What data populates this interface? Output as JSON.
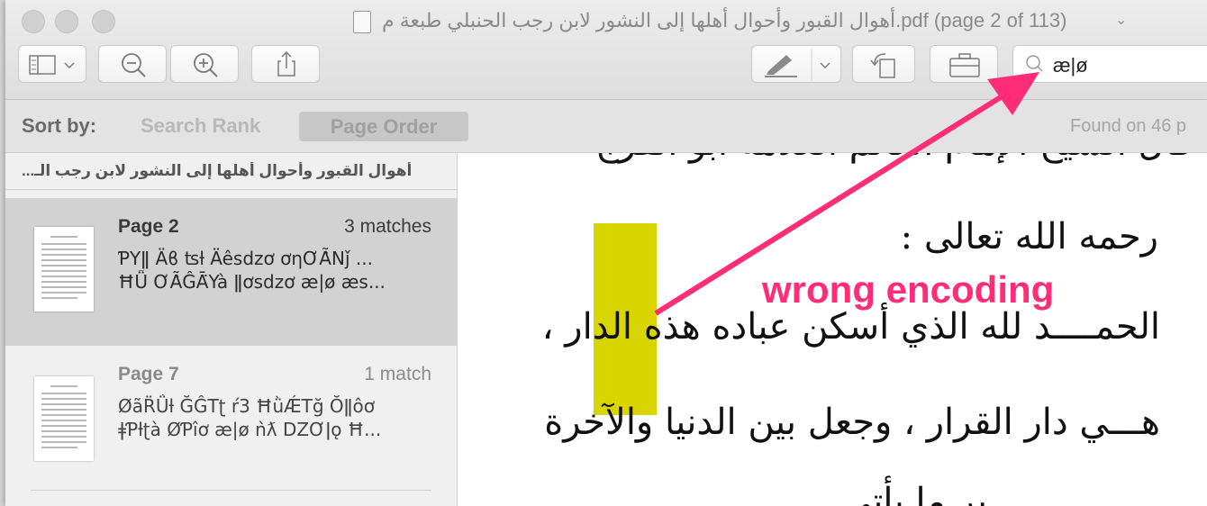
{
  "window": {
    "title": "أهوال القبور وأحوال أهلها إلى النشور لابن رجب الحنبلي طبعة م.pdf (page 2 of 113)"
  },
  "toolbar": {
    "buttons": [
      "sidebar-toggle",
      "zoom-out",
      "zoom-in",
      "share",
      "markup",
      "rotate",
      "toolbox"
    ],
    "search_value": "æ|ø"
  },
  "sortbar": {
    "label": "Sort by:",
    "options": [
      "Search Rank",
      "Page Order"
    ],
    "selected": "Page Order",
    "found": "Found on 46 p"
  },
  "sidebar": {
    "document_title": "أهوال القبور وأحوال أهلها إلى النشور لابن رجب الـ...",
    "results": [
      {
        "page": "Page 2",
        "matches": "3 matches",
        "snippet_line1": "ƤYǁ Äϐ ʦƚ Äêsdzơ ơƞƠÃ̀Nǰ ...",
        "snippet_line2": "ĦǕ ƠÃ̀ĜĀ̈Yà ǁơsdzơ æ|ø æs...",
        "selected": true
      },
      {
        "page": "Page 7",
        "matches": "1 match",
        "snippet_line1": "ØãR̈Ǘƚ ĞĜTʈ ŕ3 ĦǜǼTğ Ŏǁôơ",
        "snippet_line2": "ǂƤƚʈà ØƤîơ æ|ø ǹƛ DZƠǀǫ Ħ...",
        "selected": false
      }
    ]
  },
  "document": {
    "line1": "قال الشيخ الإمام العالم العلامة أبو الفرج",
    "line2": "رحمه الله تعالى :",
    "line3": "الحمــــد لله الذي أسكن عباده هذه الدار ،",
    "line4": "هـــي دار القرار ، وجعل بين الدنيا والآخرة",
    "line5": "بر ما يأتي"
  },
  "annotation": {
    "text": "wrong encoding",
    "color": "#ff2d78"
  },
  "colors": {
    "highlight": "#d9d500"
  }
}
